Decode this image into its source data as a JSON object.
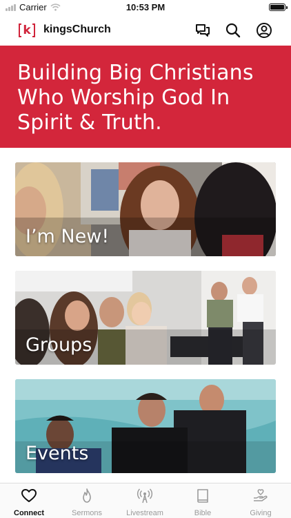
{
  "status_bar": {
    "carrier": "Carrier",
    "time": "10:53 PM"
  },
  "header": {
    "logo_letter": "k",
    "title": "kingsChurch",
    "icons": [
      "chat-icon",
      "search-icon",
      "profile-icon"
    ]
  },
  "hero": {
    "text": "Building Big Christians Who Worship God In Spirit & Truth.",
    "background_color": "#d3263b"
  },
  "cards": [
    {
      "label": "I’m New!"
    },
    {
      "label": "Groups"
    },
    {
      "label": "Events"
    }
  ],
  "tabs": [
    {
      "label": "Connect",
      "icon": "heart-icon",
      "active": true
    },
    {
      "label": "Sermons",
      "icon": "flame-icon",
      "active": false
    },
    {
      "label": "Livestream",
      "icon": "broadcast-icon",
      "active": false
    },
    {
      "label": "Bible",
      "icon": "book-icon",
      "active": false
    },
    {
      "label": "Giving",
      "icon": "giving-hand-icon",
      "active": false
    }
  ],
  "colors": {
    "brand_red": "#d3263b",
    "tab_inactive": "#9a9a9a",
    "tab_active": "#111111"
  }
}
